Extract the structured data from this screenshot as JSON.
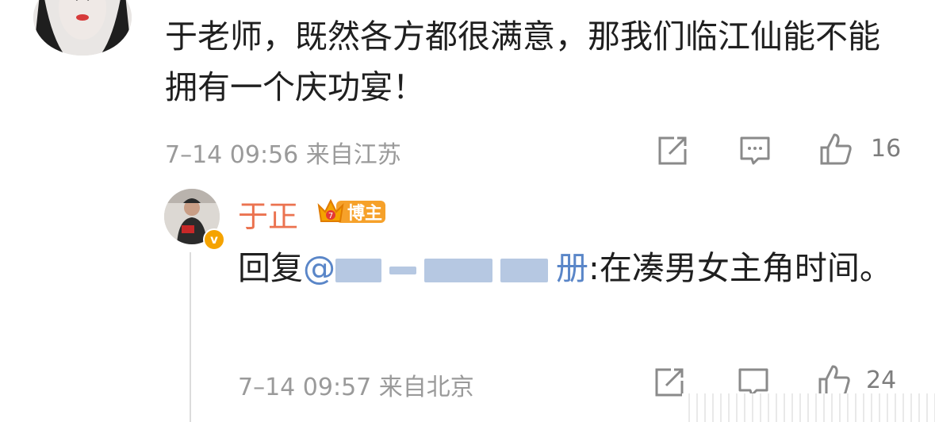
{
  "comment": {
    "text": "于老师，既然各方都很满意，那我们临江仙能不能拥有一个庆功宴！",
    "meta": "7–14 09:56 来自江苏",
    "like_count": "16"
  },
  "reply": {
    "author": "于正",
    "badge_label": "博主",
    "verified_mark": "v",
    "prefix": "回复",
    "mention_at": "@",
    "mention_tail": "册",
    "text": ":在凑男女主角时间。",
    "meta": "7–14 09:57 来自北京",
    "like_count_partial": "24"
  },
  "icons": [
    "share-icon",
    "comment-icon",
    "like-icon"
  ],
  "colors": {
    "username": "#eb7350",
    "mention": "#5a86c8",
    "meta": "#9a9a9a",
    "badge": "#f5a300"
  }
}
